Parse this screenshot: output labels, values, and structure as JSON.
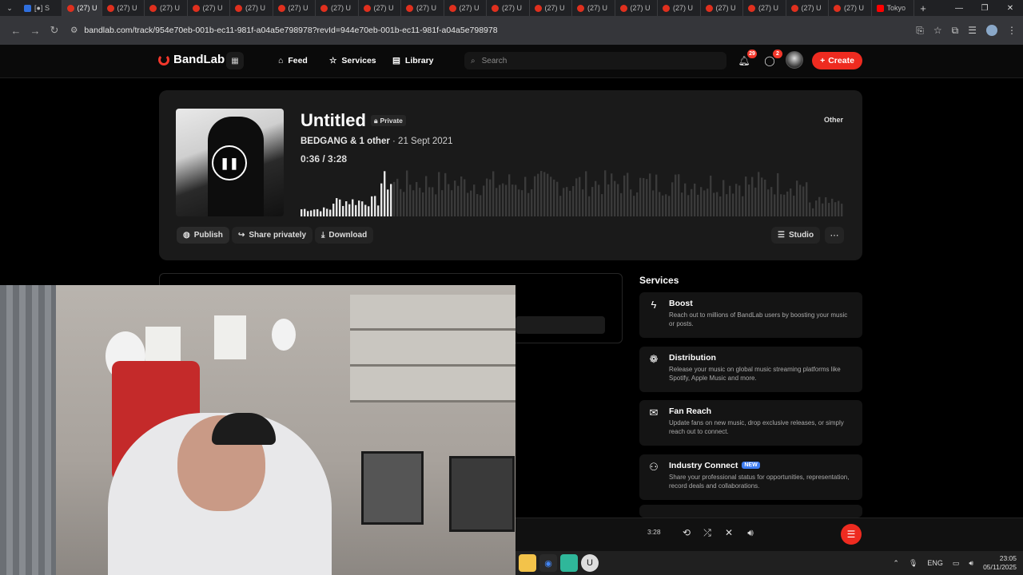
{
  "browser": {
    "tabs": [
      {
        "label": "[●] S",
        "kind": "blue"
      },
      {
        "label": "(27) U",
        "kind": "bl",
        "active": true
      },
      {
        "label": "(27) U",
        "kind": "bl"
      },
      {
        "label": "(27) U",
        "kind": "bl"
      },
      {
        "label": "(27) U",
        "kind": "bl"
      },
      {
        "label": "(27) U",
        "kind": "bl"
      },
      {
        "label": "(27) U",
        "kind": "bl"
      },
      {
        "label": "(27) U",
        "kind": "bl"
      },
      {
        "label": "(27) U",
        "kind": "bl"
      },
      {
        "label": "(27) U",
        "kind": "bl"
      },
      {
        "label": "(27) U",
        "kind": "bl"
      },
      {
        "label": "(27) U",
        "kind": "bl"
      },
      {
        "label": "(27) U",
        "kind": "bl"
      },
      {
        "label": "(27) U",
        "kind": "bl"
      },
      {
        "label": "(27) U",
        "kind": "bl"
      },
      {
        "label": "(27) U",
        "kind": "bl"
      },
      {
        "label": "(27) U",
        "kind": "bl"
      },
      {
        "label": "(27) U",
        "kind": "bl"
      },
      {
        "label": "(27) U",
        "kind": "bl"
      },
      {
        "label": "(27) U",
        "kind": "bl"
      },
      {
        "label": "Tokyo",
        "kind": "yt"
      }
    ],
    "url": "bandlab.com/track/954e70eb-001b-ec11-981f-a04a5e798978?revId=944e70eb-001b-ec11-981f-a04a5e798978"
  },
  "header": {
    "logo": "BandLab",
    "nav": [
      "Feed",
      "Services",
      "Library"
    ],
    "search_placeholder": "Search",
    "notifications_count": "29",
    "messages_count": "2",
    "create_label": "Create"
  },
  "track": {
    "title": "Untitled",
    "visibility": "Private",
    "artist": "BEDGANG & 1 other",
    "date": "· 21 Sept 2021",
    "time": "0:36 /  3:28",
    "genre": "Other",
    "progress": 0.17,
    "actions": [
      "Publish",
      "Share privately",
      "Download"
    ],
    "studio_label": "Studio"
  },
  "services": {
    "title": "Services",
    "items": [
      {
        "name": "Boost",
        "desc": "Reach out to millions of BandLab users by boosting your music or posts.",
        "icon": "lightning-icon",
        "new": ""
      },
      {
        "name": "Distribution",
        "desc": "Release your music on global music streaming platforms like Spotify, Apple Music and more.",
        "icon": "distribution-icon",
        "new": ""
      },
      {
        "name": "Fan Reach",
        "desc": "Update fans on new music, drop exclusive releases, or simply reach out to connect.",
        "icon": "envelope-icon",
        "new": ""
      },
      {
        "name": "Industry Connect",
        "desc": "Share your professional status for opportunities, representation, record deals and collaborations.",
        "icon": "people-icon",
        "new": "NEW"
      }
    ]
  },
  "player": {
    "duration": "3:28"
  },
  "taskbar": {
    "language": "ENG",
    "time": "23:05",
    "date": "05/11/2025"
  },
  "colors": {
    "accent": "#ee2b20",
    "background": "#000000",
    "card": "#1a1a1a"
  }
}
